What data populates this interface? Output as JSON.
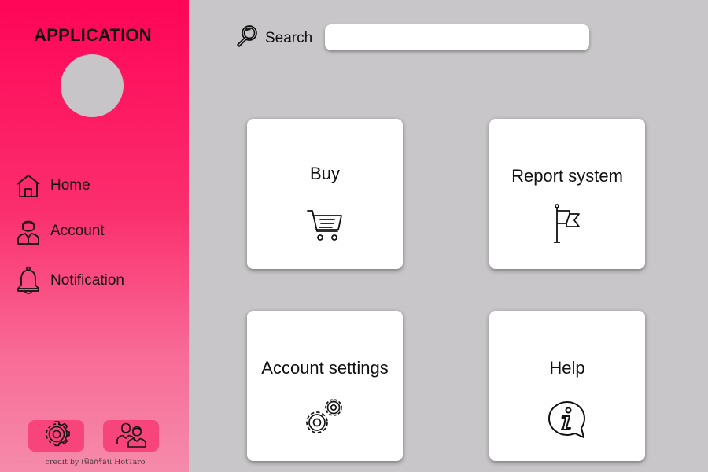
{
  "app": {
    "title": "APPLICATION"
  },
  "sidebar": {
    "items": [
      {
        "label": "Home",
        "icon": "home-icon"
      },
      {
        "label": "Account",
        "icon": "user-icon"
      },
      {
        "label": "Notification",
        "icon": "bell-icon"
      }
    ],
    "bottom_buttons": [
      {
        "icon": "gear-icon"
      },
      {
        "icon": "users-icon"
      }
    ],
    "credit": "credit by เฟือกร้อน HotTaro"
  },
  "search": {
    "label": "Search",
    "value": "",
    "placeholder": ""
  },
  "cards": [
    {
      "label": "Buy",
      "icon": "cart-icon"
    },
    {
      "label": "Report system",
      "icon": "flag-icon"
    },
    {
      "label": "Account settings",
      "icon": "gears-icon"
    },
    {
      "label": "Help",
      "icon": "info-icon"
    }
  ],
  "colors": {
    "sidebar_top": "#ff0558",
    "sidebar_bottom": "#f58bab",
    "main_background": "#c8c6c8",
    "card_background": "#ffffff",
    "bottom_button": "#f7457c"
  }
}
